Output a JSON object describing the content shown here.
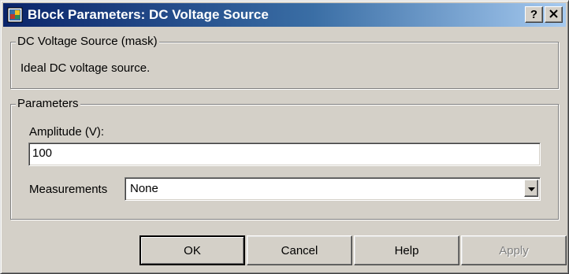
{
  "window": {
    "title": "Block Parameters: DC Voltage Source",
    "icon": "simulink-block-icon",
    "help_button": "?",
    "close_button": "×"
  },
  "mask_group": {
    "legend": "DC Voltage Source (mask)",
    "description": "Ideal DC voltage source."
  },
  "params_group": {
    "legend": "Parameters",
    "amplitude_label": "Amplitude (V):",
    "amplitude_value": "100",
    "measurements_label": "Measurements",
    "measurements_value": "None"
  },
  "buttons": {
    "ok": "OK",
    "cancel": "Cancel",
    "help": "Help",
    "apply": "Apply"
  },
  "colors": {
    "face": "#d4d0c8",
    "title_start": "#0a246a",
    "title_end": "#a6caf0",
    "disabled_text": "#808080"
  }
}
